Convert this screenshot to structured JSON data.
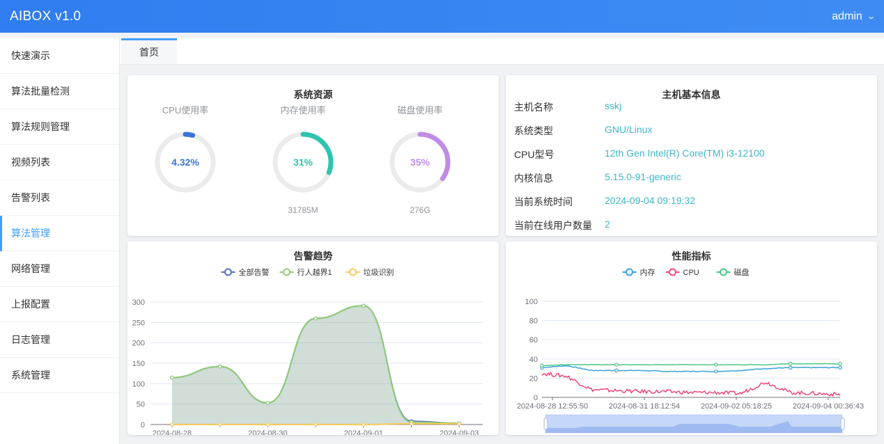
{
  "app": {
    "title": "AIBOX v1.0",
    "user": "admin"
  },
  "sidebar": {
    "items": [
      {
        "label": "快速演示"
      },
      {
        "label": "算法批量检测"
      },
      {
        "label": "算法规则管理"
      },
      {
        "label": "视频列表"
      },
      {
        "label": "告警列表"
      },
      {
        "label": "算法管理",
        "active": true
      },
      {
        "label": "网络管理"
      },
      {
        "label": "上报配置"
      },
      {
        "label": "日志管理"
      },
      {
        "label": "系统管理"
      }
    ]
  },
  "tabs": [
    {
      "label": "首页"
    }
  ],
  "resources": {
    "title": "系统资源",
    "cpu": {
      "label": "CPU使用率",
      "value": "4.32%",
      "percent": 4.32,
      "color": "#3b74d6"
    },
    "mem": {
      "label": "内存使用率",
      "value": "31%",
      "percent": 31,
      "color": "#2ec4b0",
      "sub": "31785M"
    },
    "disk": {
      "label": "磁盘使用率",
      "value": "35%",
      "percent": 35,
      "color": "#c08ce6",
      "sub": "276G"
    }
  },
  "host": {
    "title": "主机基本信息",
    "rows": [
      {
        "label": "主机名称",
        "value": "sskj"
      },
      {
        "label": "系统类型",
        "value": "GNU/Linux"
      },
      {
        "label": "CPU型号",
        "value": "12th Gen Intel(R) Core(TM) i3-12100"
      },
      {
        "label": "内核信息",
        "value": "5.15.0-91-generic"
      },
      {
        "label": "当前系统时间",
        "value": "2024-09-04 09:19:32"
      },
      {
        "label": "当前在线用户数量",
        "value": "2"
      }
    ]
  },
  "alerts": {
    "title": "告警趋势",
    "chart_data": {
      "type": "line",
      "title": "告警趋势",
      "x": [
        "2024-08-28",
        "2024-08-29",
        "2024-08-30",
        "2024-08-31",
        "2024-09-01",
        "2024-09-02",
        "2024-09-03"
      ],
      "tick_labels": [
        "2024-08-28",
        "2024-08-30",
        "2024-09-01",
        "2024-09-03"
      ],
      "ylim": [
        0,
        300
      ],
      "yticks": [
        0,
        50,
        100,
        150,
        200,
        250,
        300
      ],
      "series": [
        {
          "name": "全部告警",
          "color": "#5470c6",
          "values": [
            115,
            142,
            53,
            260,
            291,
            8,
            3
          ]
        },
        {
          "name": "行人越界1",
          "color": "#91cc75",
          "values": [
            115,
            142,
            53,
            260,
            291,
            6,
            3
          ]
        },
        {
          "name": "垃圾识别",
          "color": "#fac858",
          "values": [
            0,
            0,
            0,
            0,
            0,
            2,
            2
          ]
        }
      ],
      "area": true
    }
  },
  "perf": {
    "title": "性能指标",
    "chart_data": {
      "type": "line",
      "title": "性能指标",
      "x_ticks": [
        "2024-08-28 12:55:50",
        "2024-08-31 18:12:54",
        "2024-09-02 05:18:25",
        "2024-09-04 00:36:43"
      ],
      "ylim": [
        0,
        100
      ],
      "yticks": [
        0,
        20,
        40,
        60,
        80,
        100
      ],
      "series": [
        {
          "name": "内存",
          "color": "#3ba2d6",
          "values": [
            31,
            33,
            28,
            28,
            28,
            27,
            27,
            27,
            28,
            30,
            31,
            31,
            31
          ]
        },
        {
          "name": "CPU",
          "color": "#f0467a",
          "values": [
            25,
            22,
            8,
            7,
            6,
            6,
            5,
            5,
            4,
            16,
            5,
            4,
            3
          ]
        },
        {
          "name": "磁盘",
          "color": "#4cc885",
          "values": [
            33,
            34,
            34,
            34,
            34,
            34,
            34,
            34,
            34,
            34,
            35,
            35,
            35
          ]
        }
      ]
    }
  }
}
